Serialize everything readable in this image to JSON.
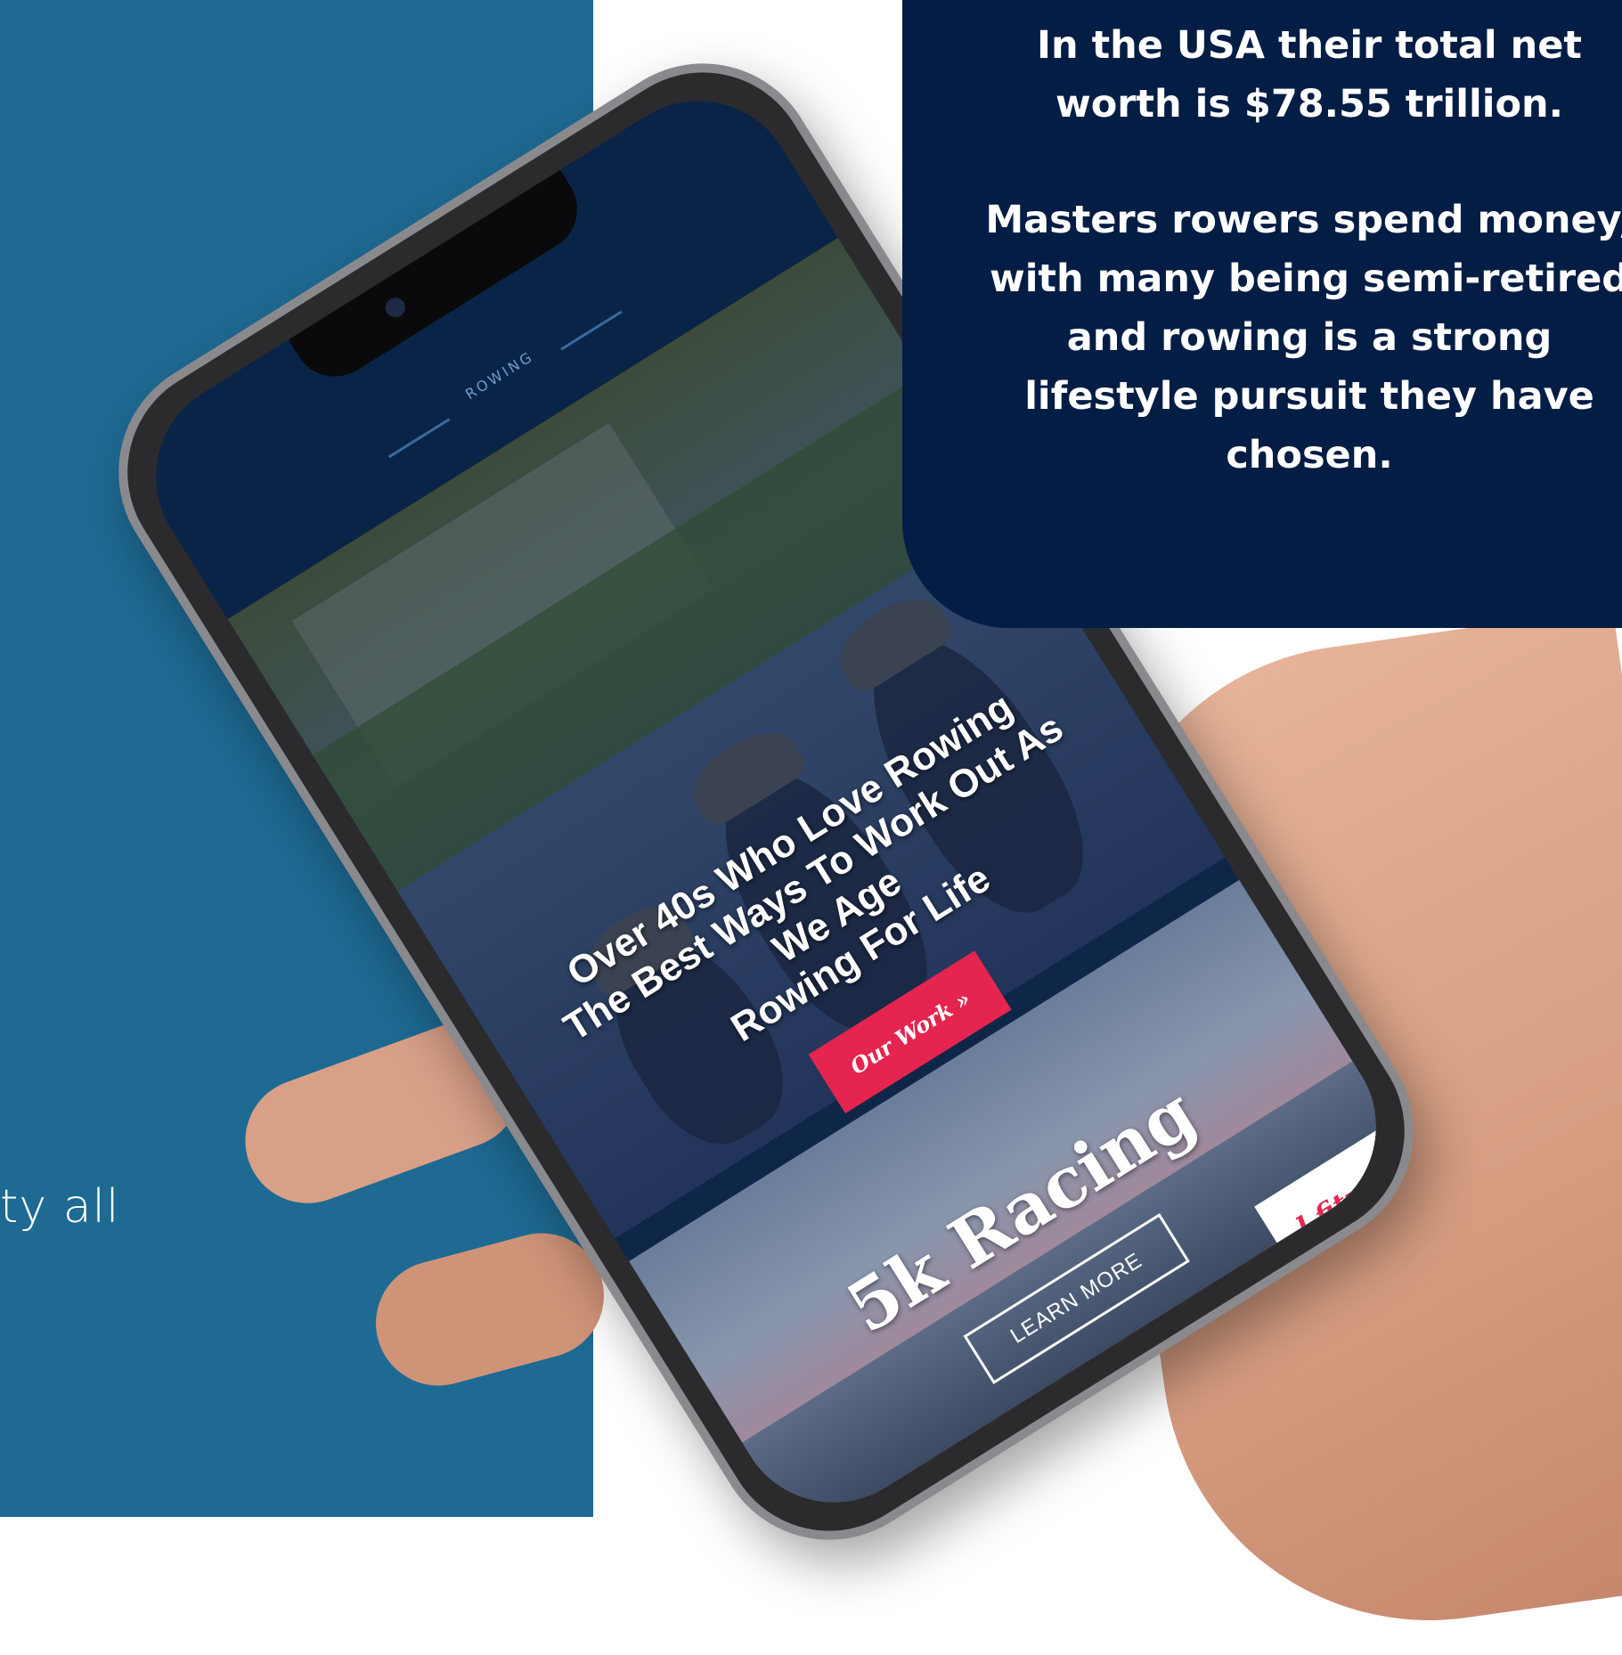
{
  "info_card": {
    "paragraph1": "In the USA their total net worth is $78.55 trillion.",
    "paragraph2": "Masters rowers spend money, with many being semi-retired and rowing is a strong lifestyle pursuit they have chosen."
  },
  "side_text": "ty all",
  "phone": {
    "logo": "ROWING",
    "hero": {
      "line1": "Over 40s Who Love Rowing",
      "line2": "The Best Ways To Work Out As",
      "line3": "We Age",
      "line4": "Rowing For Life",
      "button": "Our Work »"
    },
    "racing": {
      "title": "5k Racing",
      "button": "LEARN MORE"
    },
    "footer_text": "l fitness"
  },
  "colors": {
    "left_panel": "#1e6a93",
    "info_card": "#031d44",
    "accent_red": "#e5254f"
  }
}
